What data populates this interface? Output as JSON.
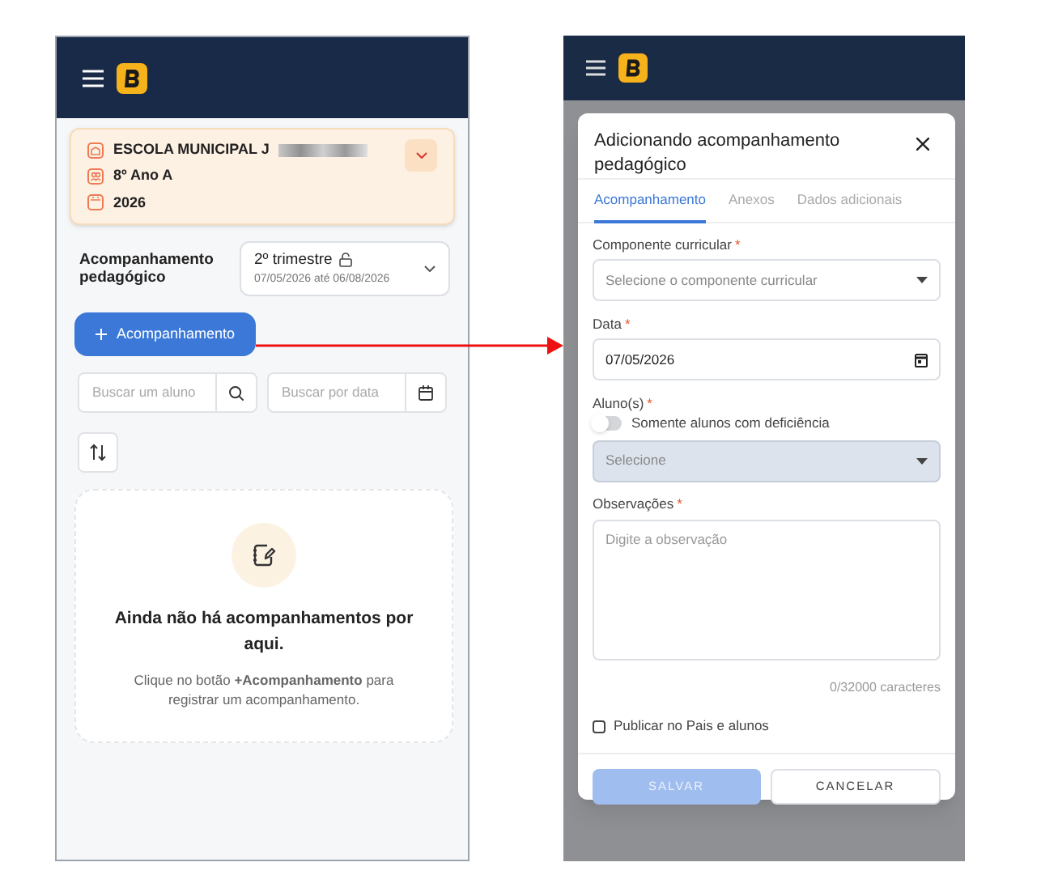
{
  "left_screen": {
    "school_card": {
      "school": "ESCOLA MUNICIPAL J",
      "class": "8º Ano A",
      "year": "2026"
    },
    "section_title": "Acompanhamento pedagógico",
    "period": {
      "name": "2º trimestre",
      "dates": "07/05/2026 até 06/08/2026"
    },
    "add_button": "Acompanhamento",
    "search_student": {
      "placeholder": "Buscar um aluno"
    },
    "search_date": {
      "placeholder": "Buscar por data"
    },
    "empty_state": {
      "title": "Ainda não há acompanhamentos por aqui.",
      "message": "Clique no botão **+Acompanhamento** para registrar um acompanhamento."
    }
  },
  "right_screen": {
    "dialog": {
      "title": "Adicionando acompanhamento pedagógico",
      "tabs": [
        {
          "label": "Acompanhamento",
          "selected": true
        },
        {
          "label": "Anexos",
          "selected": false
        },
        {
          "label": "Dados adicionais",
          "selected": false
        }
      ],
      "fields": [
        {
          "kind": "select",
          "label": "Componente curricular",
          "required_mark": "*",
          "placeholder": "Selecione o componente curricular",
          "highlighted": false
        },
        {
          "kind": "date",
          "label": "Data",
          "required_mark": "*",
          "value": "07/05/2026"
        },
        {
          "kind": "students",
          "label": "Aluno(s)",
          "required_mark": "*",
          "toggle": {
            "label": "Somente alunos com deficiência",
            "on": false
          },
          "placeholder": "Selecione",
          "highlighted": true
        },
        {
          "kind": "textarea",
          "label": "Observações",
          "required_mark": "*",
          "placeholder": "Digite a observação",
          "counter": "0/32000 caracteres"
        }
      ],
      "publish_checkbox": {
        "label": "Publicar no Pais e alunos",
        "checked": false
      },
      "buttons": [
        {
          "label": "SALVAR",
          "disabled": true
        },
        {
          "label": "CANCELAR",
          "disabled": false
        }
      ]
    }
  }
}
